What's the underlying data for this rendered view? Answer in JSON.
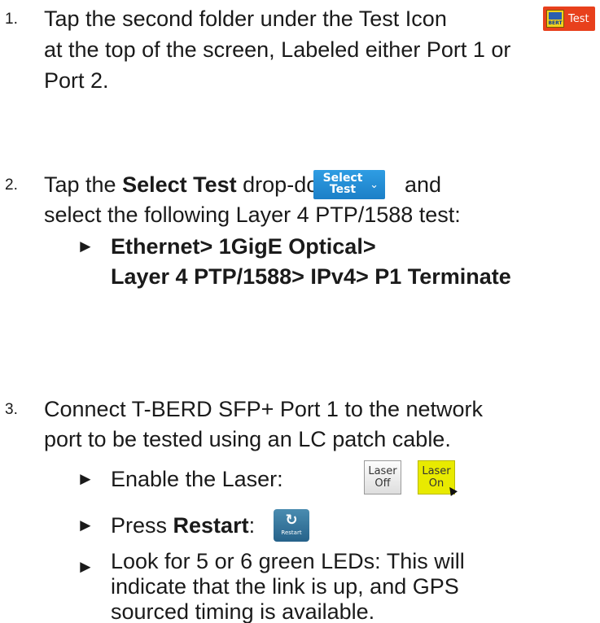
{
  "steps": [
    {
      "number": "1.",
      "lines": [
        "Tap the second folder under the Test Icon",
        "at the top of the screen, Labeled either Port 1 or",
        "Port 2."
      ],
      "test_icon": {
        "badge": "BERT",
        "label": "Test",
        "icon": "bert-test-icon"
      }
    },
    {
      "number": "2.",
      "line1_pre": "Tap the ",
      "line1_bold": "Select Test",
      "line1_post": " drop-down",
      "line1_end": "and",
      "line2": "select the following Layer 4 PTP/1588 test:",
      "select_button": {
        "line1": "Select",
        "line2": "Test",
        "icon": "chevron-down-icon"
      },
      "bullet": "►",
      "path_line1": "Ethernet> 1GigE Optical>",
      "path_line2": "Layer 4 PTP/1588> IPv4> P1 Terminate"
    },
    {
      "number": "3.",
      "line1": "Connect T-BERD SFP+ Port 1 to the network",
      "line2": "port to be tested using an LC patch cable.",
      "bullets": [
        {
          "symbol": "►",
          "text": "Enable the Laser:"
        },
        {
          "symbol": "►",
          "pre": "Press ",
          "bold": "Restart",
          "post": ":"
        },
        {
          "symbol": "►",
          "lines": [
            "Look for 5 or 6 green LEDs: This will",
            "indicate that the link is up, and GPS",
            "sourced timing is available."
          ]
        }
      ],
      "laser_off": {
        "line1": "Laser",
        "line2": "Off"
      },
      "laser_on": {
        "line1": "Laser",
        "line2": "On"
      },
      "restart": {
        "icon": "restart-icon",
        "label": "Restart"
      }
    }
  ]
}
